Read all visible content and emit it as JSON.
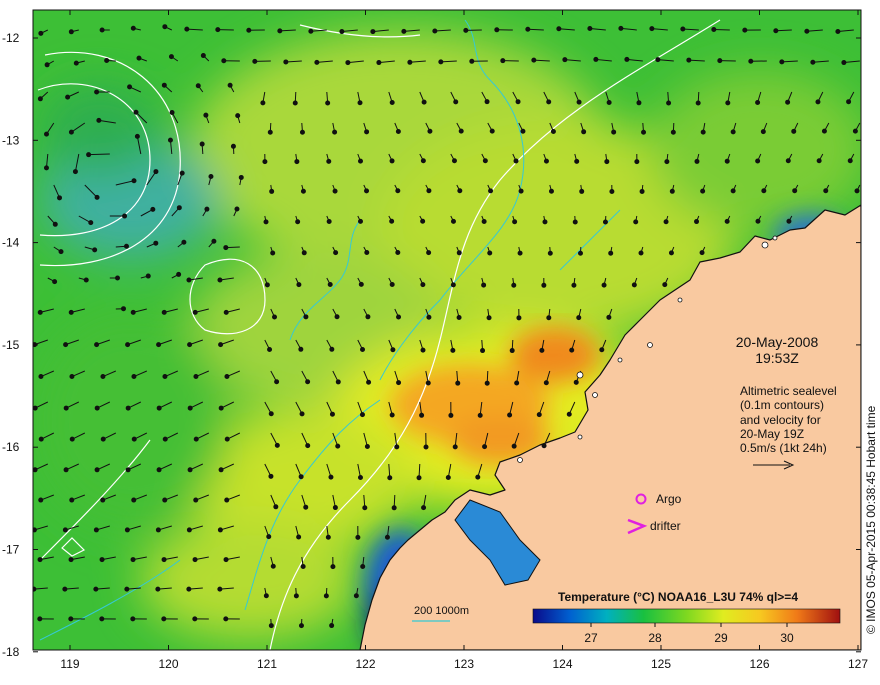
{
  "map": {
    "date": "20-May-2008",
    "time": "19:53Z",
    "altimetry_lines": [
      "Altimetric sealevel",
      "(0.1m contours)",
      "and velocity for",
      "20-May 19Z",
      "0.5m/s (1kt 24h)"
    ],
    "credit": "© IMOS 05-Apr-2015 00:38:45 Hobart time",
    "legend": {
      "argo": "Argo",
      "drifter": "drifter"
    },
    "bathymetry_scale": "200  1000m",
    "colorbar": {
      "title": "Temperature (°C) NOAA16_L3U 74% ql>=4",
      "ticks": [
        "27",
        "28",
        "29",
        "30"
      ]
    },
    "x_ticks": [
      "119",
      "120",
      "121",
      "122",
      "123",
      "124",
      "125",
      "126",
      "127"
    ],
    "y_ticks": [
      "-12",
      "-13",
      "-14",
      "-15",
      "-16",
      "-17",
      "-18"
    ],
    "colors": {
      "land": "#f9c9a0",
      "sst_cold": "#1f3fa0",
      "sst_green": "#3dbf36",
      "sst_yellow": "#e4ec20",
      "sst_warm": "#f08a1c",
      "contour": "#ffffff",
      "bathy": "#36c9d4",
      "argo": "#e020e0"
    }
  }
}
